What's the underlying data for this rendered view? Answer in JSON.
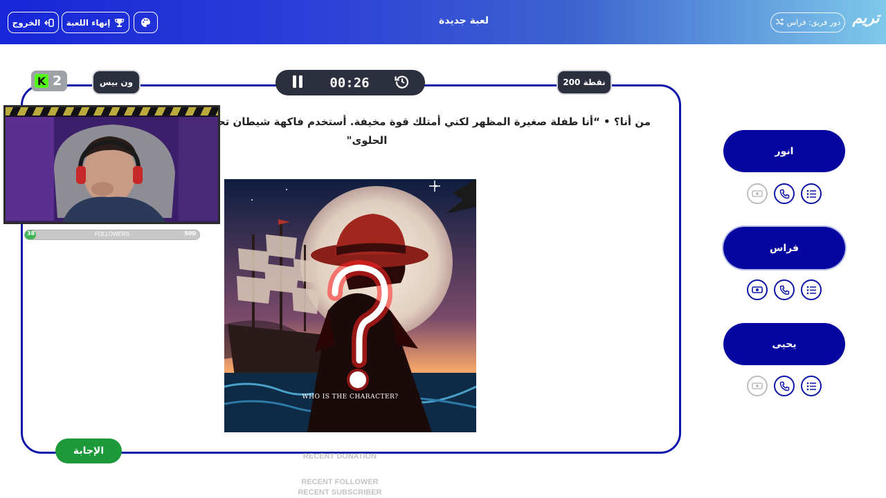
{
  "header": {
    "logo": "تريم",
    "turn_label": "دور فريق: فراس",
    "title": "لعبة جديدة",
    "end_game_label": "إنهاء اللعبة",
    "exit_label": "الخروج"
  },
  "question": {
    "category": "ون بيس",
    "points_label": "200 نقطة",
    "timer": "00:26",
    "text_line1": "من أنا؟ • “أنا طفلة صغيرة المظهر لكني أمتلك قوة مخيفة. أستخدم فاكهة شيطان تحو",
    "text_line2": "الحلوى\"",
    "image_caption": "WHO IS THE CHARACTER?",
    "answer_label": "الإجابة"
  },
  "stream_overlay": {
    "kick_logo": "K",
    "viewer_count": "2",
    "followers_label": "FOLLOWERS",
    "followers_current": "38",
    "followers_goal": "500",
    "recent_donation": "RECENT DONATION",
    "recent_follower": "RECENT FOLLOWER",
    "recent_subscriber": "RECENT SUBSCRIBER"
  },
  "teams": [
    {
      "name": "انور",
      "active": false,
      "tools": [
        {
          "icon": "swap-icon",
          "used": true
        },
        {
          "icon": "phone-icon",
          "used": false
        },
        {
          "icon": "list-icon",
          "used": false
        }
      ]
    },
    {
      "name": "فراس",
      "active": true,
      "tools": [
        {
          "icon": "swap-icon",
          "used": false
        },
        {
          "icon": "phone-icon",
          "used": false
        },
        {
          "icon": "list-icon",
          "used": false
        }
      ]
    },
    {
      "name": "يحيى",
      "active": false,
      "tools": [
        {
          "icon": "swap-icon",
          "used": true
        },
        {
          "icon": "phone-icon",
          "used": false
        },
        {
          "icon": "list-icon",
          "used": false
        }
      ]
    }
  ],
  "colors": {
    "brand_blue": "#0505a0",
    "card_border": "#0d14a8",
    "answer_green": "#1c9a3a",
    "dark_pill": "#2c2f3d"
  }
}
